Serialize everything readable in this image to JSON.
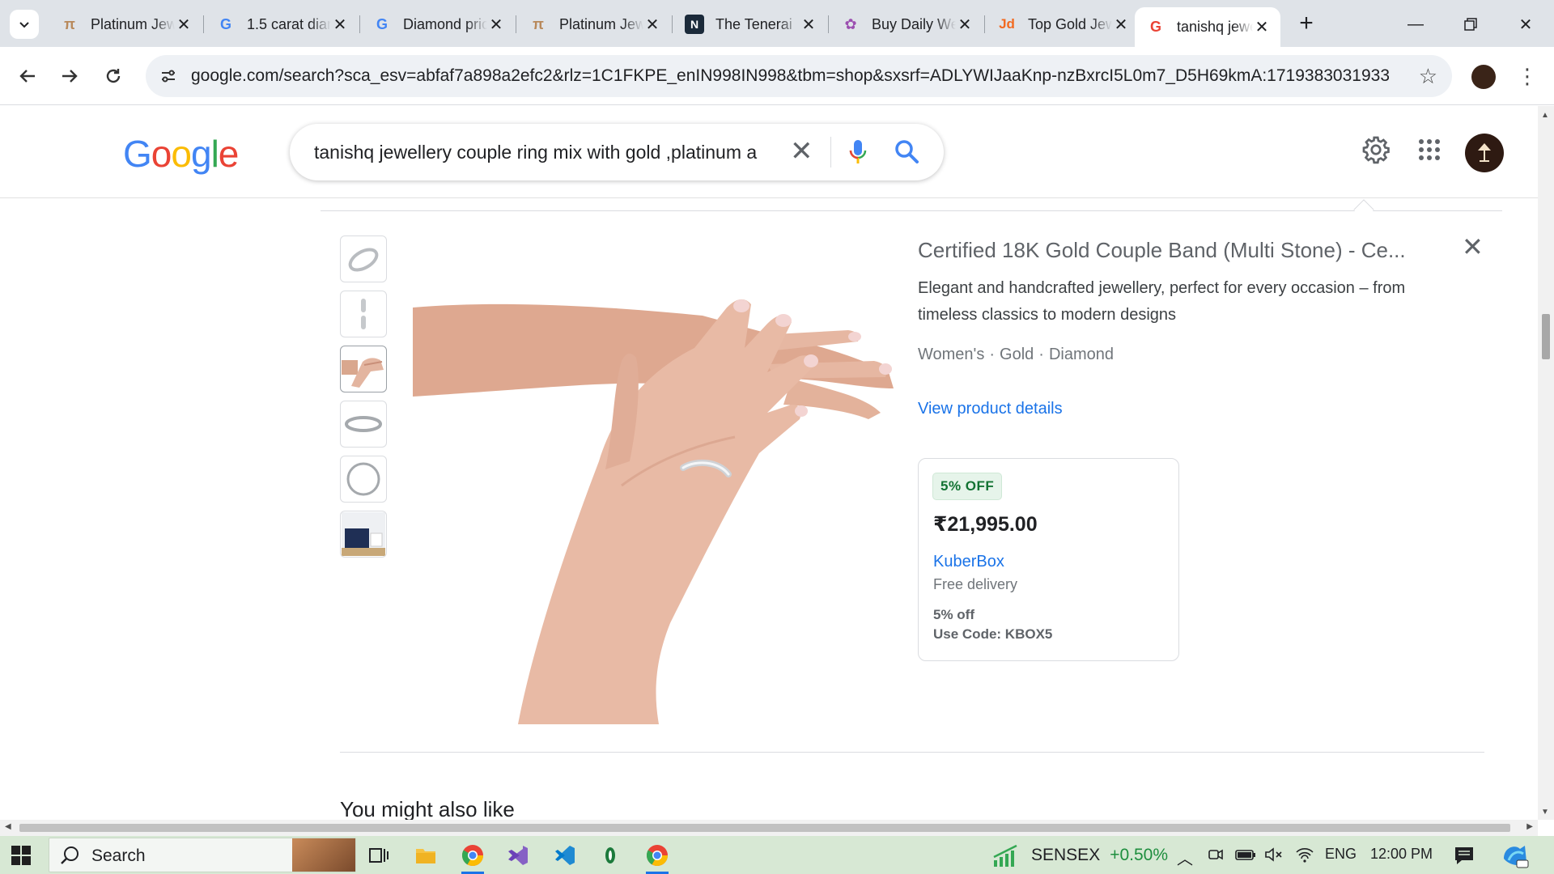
{
  "browser": {
    "tabs": [
      {
        "title": "Platinum Jewellery",
        "favicon": "tanishq-icon"
      },
      {
        "title": "1.5 carat diamond",
        "favicon": "google-icon"
      },
      {
        "title": "Diamond price",
        "favicon": "google-icon"
      },
      {
        "title": "Platinum Jewellery",
        "favicon": "tanishq-icon"
      },
      {
        "title": "The Tenerai",
        "favicon": "tenerai-icon"
      },
      {
        "title": "Buy Daily Wear",
        "favicon": "flower-icon"
      },
      {
        "title": "Top Gold Jewellers",
        "favicon": "justdial-icon"
      },
      {
        "title": "tanishq jewellery",
        "favicon": "google-icon",
        "active": true
      }
    ],
    "url": "google.com/search?sca_esv=abfaf7a898a2efc2&rlz=1C1FKPE_enIN998IN998&tbm=shop&sxsrf=ADLYWIJaaKnp-nzBxrcI5L0m7_D5H69kmA:1719383031933&q=..."
  },
  "google": {
    "logo": [
      "G",
      "o",
      "o",
      "g",
      "l",
      "e"
    ],
    "query": "tanishq jewellery couple ring mix with gold ,platinum a"
  },
  "product": {
    "title": "Certified 18K Gold Couple Band (Multi Stone) - Ce...",
    "description": "Elegant and handcrafted jewellery, perfect for every occasion – from timeless classics to modern designs",
    "attributes": [
      "Women's",
      "Gold",
      "Diamond"
    ],
    "attr_sep": "·",
    "details_link": "View product details",
    "offer": {
      "badge": "5% OFF",
      "price": "₹21,995.00",
      "seller": "KuberBox",
      "delivery": "Free delivery",
      "discount": "5% off",
      "code": "Use Code: KBOX5"
    },
    "thumbnails": [
      "ring-angled",
      "ring-side",
      "ring-on-hand",
      "ring-flat",
      "ring-top",
      "ring-box"
    ]
  },
  "sections": {
    "also_like": "You might also like"
  },
  "taskbar": {
    "search_label": "Search",
    "sensex_name": "SENSEX",
    "sensex_change": "+0.50%",
    "lang": "ENG",
    "time": "12:00 PM"
  },
  "colors": {
    "link": "#1a73e8",
    "offer_badge_bg": "#e6f4ea",
    "offer_badge_text": "#137333",
    "sensex_up": "#1e8e3e"
  }
}
